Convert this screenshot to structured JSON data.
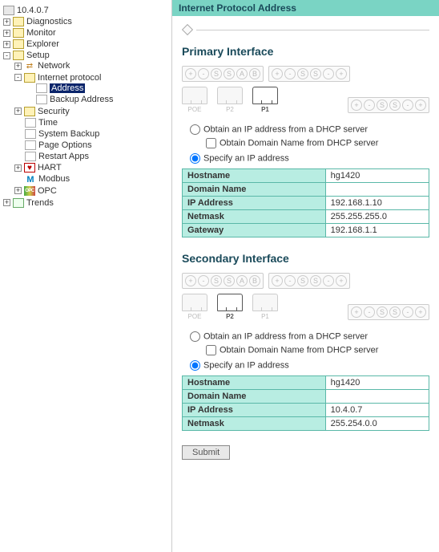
{
  "title": "Internet Protocol Address",
  "tree": {
    "root": "10.4.0.7",
    "diagnostics": "Diagnostics",
    "monitor": "Monitor",
    "explorer": "Explorer",
    "setup": "Setup",
    "network": "Network",
    "internet_protocol": "Internet protocol",
    "address": "Address",
    "backup_address": "Backup Address",
    "security": "Security",
    "time": "Time",
    "system_backup": "System Backup",
    "page_options": "Page Options",
    "restart_apps": "Restart Apps",
    "hart": "HART",
    "modbus": "Modbus",
    "opc": "OPC",
    "trends": "Trends"
  },
  "primary": {
    "title": "Primary Interface",
    "ports": {
      "poe": "POE",
      "p2": "P2",
      "p1": "P1"
    },
    "active_port": "P1",
    "dhcp_label": "Obtain an IP address from a DHCP server",
    "dhcp_domain_label": "Obtain Domain Name from DHCP server",
    "specify_label": "Specify an IP address",
    "mode": "specify",
    "fields": {
      "hostname_label": "Hostname",
      "hostname": "hg1420",
      "domain_label": "Domain Name",
      "domain": "",
      "ip_label": "IP Address",
      "ip": "192.168.1.10",
      "netmask_label": "Netmask",
      "netmask": "255.255.255.0",
      "gateway_label": "Gateway",
      "gateway": "192.168.1.1"
    }
  },
  "secondary": {
    "title": "Secondary Interface",
    "ports": {
      "poe": "POE",
      "p2": "P2",
      "p1": "P1"
    },
    "active_port": "P2",
    "dhcp_label": "Obtain an IP address from a DHCP server",
    "dhcp_domain_label": "Obtain Domain Name from DHCP server",
    "specify_label": "Specify an IP address",
    "mode": "specify",
    "fields": {
      "hostname_label": "Hostname",
      "hostname": "hg1420",
      "domain_label": "Domain Name",
      "domain": "",
      "ip_label": "IP Address",
      "ip": "10.4.0.7",
      "netmask_label": "Netmask",
      "netmask": "255.254.0.0"
    }
  },
  "submit_label": "Submit",
  "chip_symbols": {
    "plus": "+",
    "minus": "-",
    "s": "S",
    "a": "A",
    "b": "B"
  }
}
